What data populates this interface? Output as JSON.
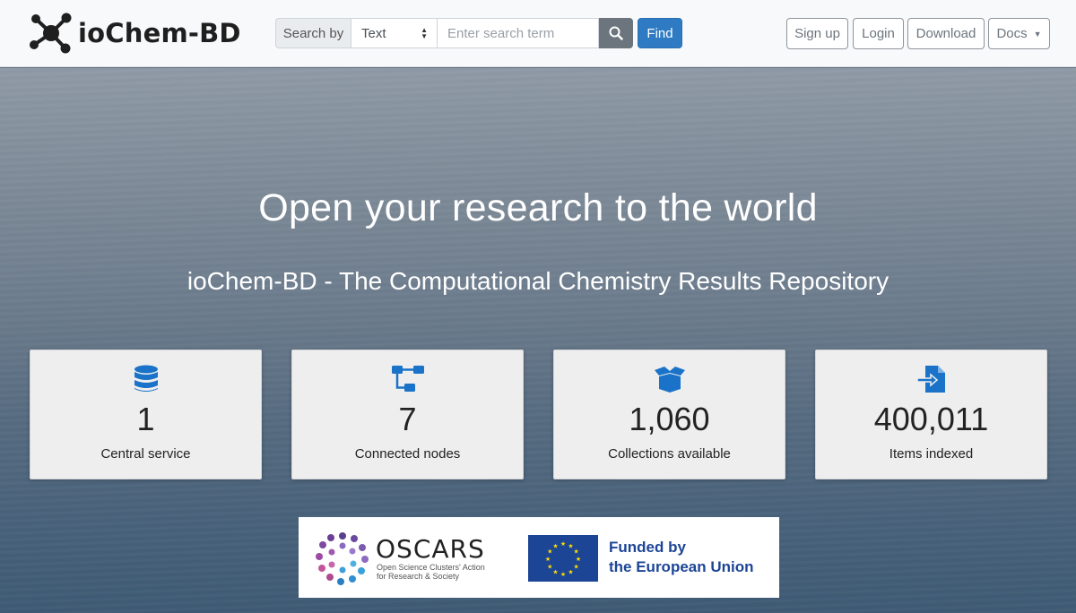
{
  "brand": {
    "name": "ioChem-BD",
    "icon": "molecule-logo-icon"
  },
  "search": {
    "label": "Search by",
    "select_value": "Text",
    "placeholder": "Enter search term",
    "search_icon": "magnifier-icon",
    "find_label": "Find"
  },
  "nav": {
    "signup": "Sign up",
    "login": "Login",
    "download": "Download",
    "docs": "Docs"
  },
  "hero": {
    "title": "Open your research to the world",
    "subtitle": "ioChem-BD - The Computational Chemistry Results Repository"
  },
  "stats": [
    {
      "value": "1",
      "label": "Central service",
      "icon": "database-icon"
    },
    {
      "value": "7",
      "label": "Connected nodes",
      "icon": "sitemap-icon"
    },
    {
      "value": "1,060",
      "label": "Collections available",
      "icon": "box-open-icon"
    },
    {
      "value": "400,011",
      "label": "Items indexed",
      "icon": "file-import-icon"
    }
  ],
  "funding": {
    "oscars_name": "OSCARS",
    "oscars_line1": "Open Science Clusters' Action",
    "oscars_line2": "for Research & Society",
    "eu_line1": "Funded by",
    "eu_line2": "the European Union"
  },
  "colors": {
    "primary": "#2e7bc4",
    "icon_blue": "#1a73c9",
    "eu_blue": "#1c4596",
    "eu_yellow": "#ffdd00"
  }
}
